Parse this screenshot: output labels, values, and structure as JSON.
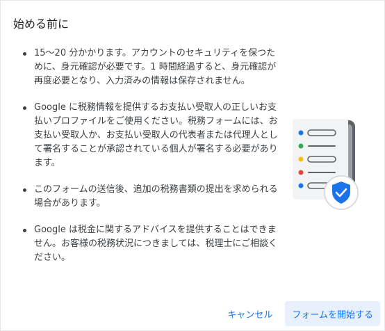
{
  "dialog": {
    "title": "始める前に",
    "items": [
      "15〜20 分かかります。アカウントのセキュリティを保つために、身元確認が必要です。1 時間経過すると、身元確認が再度必要となり、入力済みの情報は保存されません。",
      "Google に税務情報を提供するお支払い受取人の正しいお支払いプロファイルをご使用ください。税務フォームには、お支払い受取人か、お支払い受取人の代表者または代理人として署名することが承認されている個人が署名する必要があります。",
      "このフォームの送信後、追加の税務書類の提出を求められる場合があります。",
      "Google は税金に関するアドバイスを提供することはできません。お客様の税務状況につきましては、税理士にご相談ください。"
    ],
    "illustration": {
      "icon": "document-shield-icon",
      "dot_colors": [
        "#1a73e8",
        "#34a853",
        "#fbbc04",
        "#ea4335",
        "#1a73e8"
      ]
    },
    "actions": {
      "cancel_label": "キャンセル",
      "start_label": "フォームを開始する"
    }
  }
}
